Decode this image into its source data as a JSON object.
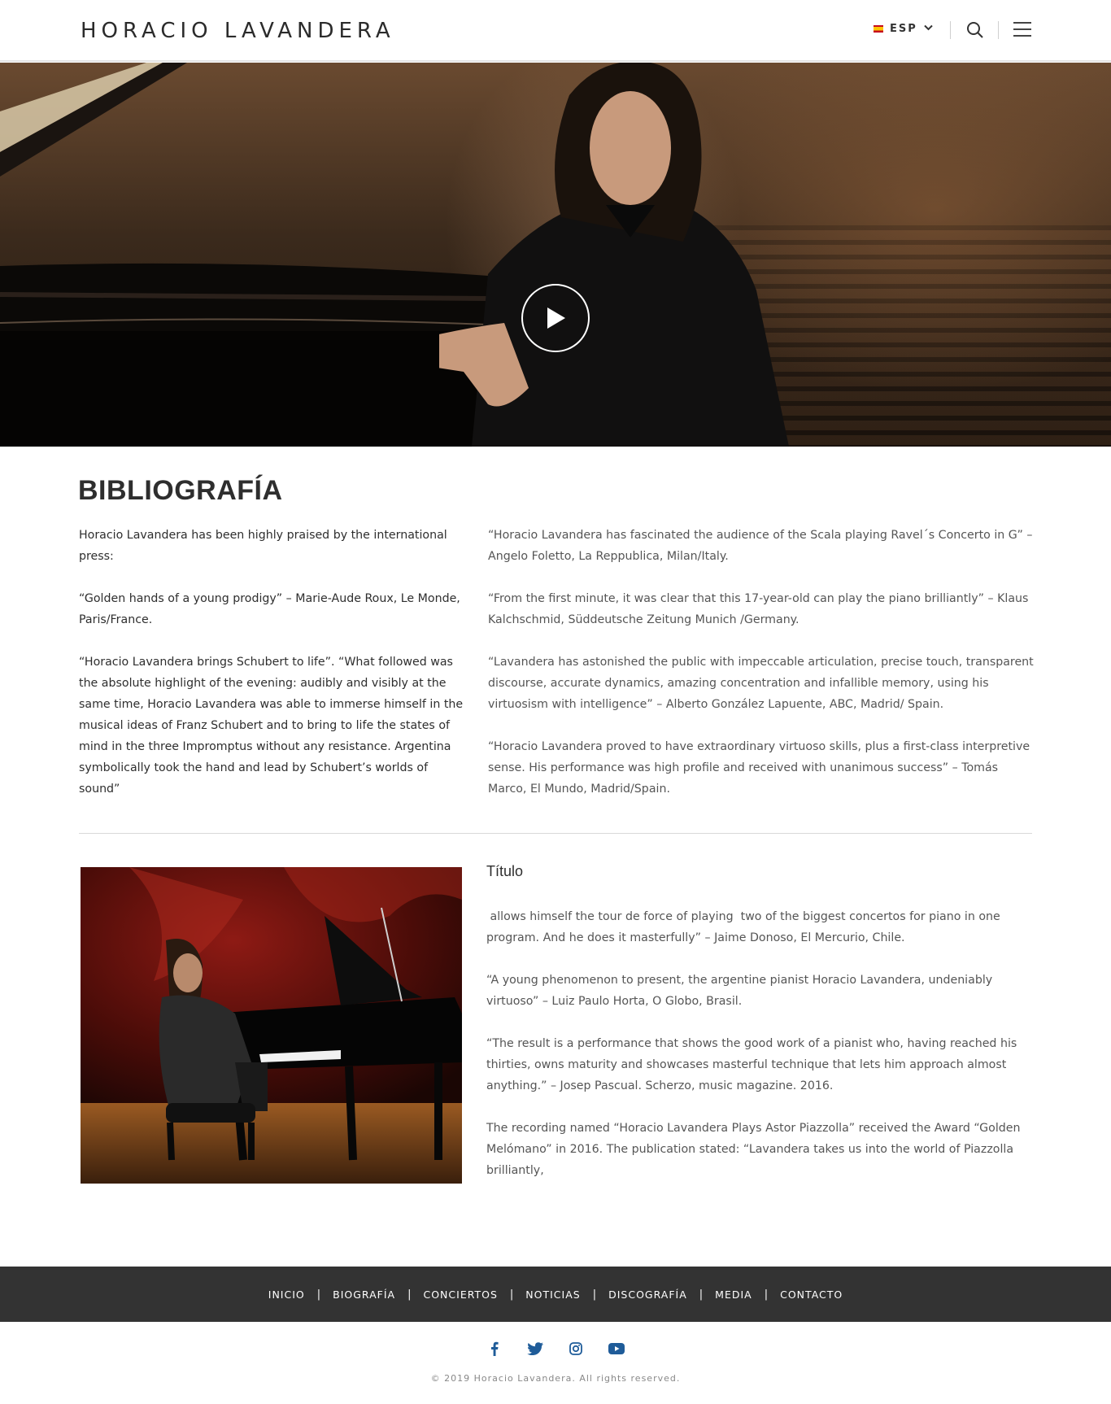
{
  "header": {
    "logo": "HORACIO LAVANDERA",
    "language": "ESP"
  },
  "hero": {
    "icons": [
      "play-icon"
    ]
  },
  "bibliography": {
    "title": "BIBLIOGRAFÍA",
    "left": [
      "Horacio Lavandera has been highly praised by the international press:",
      "“Golden hands of a young prodigy” – Marie-Aude Roux, Le Monde, Paris/France.",
      "“Horacio Lavandera brings Schubert to life”. “What followed was the absolute highlight of the evening: audibly and visibly at the same time, Horacio Lavandera was able to immerse himself in the musical ideas of Franz Schubert and to bring to life the states of mind in the three Impromptus without any resistance. Argentina symbolically took the hand and lead by Schubert’s worlds of sound”"
    ],
    "right": [
      "“Horacio Lavandera has fascinated the audience of the Scala playing Ravel´s Concerto in G” – Angelo Foletto, La Reppublica, Milan/Italy.",
      "“From the first minute, it was clear that this 17-year-old can play the piano brilliantly” – Klaus Kalchschmid, Süddeutsche Zeitung Munich /Germany.",
      "“Lavandera has astonished the public with impeccable articulation, precise touch, transparent discourse, accurate dynamics, amazing concentration and infallible memory, using his virtuosism with intelligence” – Alberto González Lapuente, ABC, Madrid/ Spain.",
      "“Horacio Lavandera proved to have extraordinary virtuoso skills, plus a first-class interpretive sense. His performance was high profile and received with unanimous success” – Tomás Marco, El Mundo, Madrid/Spain."
    ]
  },
  "second": {
    "title": "Título",
    "paragraphs": [
      " allows himself the tour de force of playing  two of the biggest concertos for piano in one program. And he does it masterfully” – Jaime Donoso, El Mercurio, Chile.",
      "“A young phenomenon to present, the argentine pianist Horacio Lavandera, undeniably virtuoso” – Luiz Paulo Horta, O Globo, Brasil.",
      "“The result is a performance that shows the good work of a pianist who,  having reached his thirties, owns maturity and showcases masterful technique that lets him approach almost anything.” – Josep Pascual. Scherzo, music magazine. 2016.",
      "The recording named “Horacio Lavandera Plays Astor Piazzolla” received the Award “Golden Melómano” in 2016. The publication stated: “Lavandera takes us into the world of Piazzolla brilliantly,"
    ]
  },
  "footer": {
    "nav": [
      "INICIO",
      "BIOGRAFÍA",
      "CONCIERTOS",
      "NOTICIAS",
      "DISCOGRAFÍA",
      "MEDIA",
      "CONTACTO"
    ],
    "separator": "|",
    "social_icons": [
      "facebook-icon",
      "twitter-icon",
      "instagram-icon",
      "youtube-icon"
    ],
    "copyright": "© 2019 Horacio Lavandera. All rights reserved."
  },
  "colors": {
    "footer_bg": "#333333",
    "social_blue": "#1f5c99",
    "flag_red": "#c60b1e",
    "flag_yellow": "#ffc400"
  }
}
